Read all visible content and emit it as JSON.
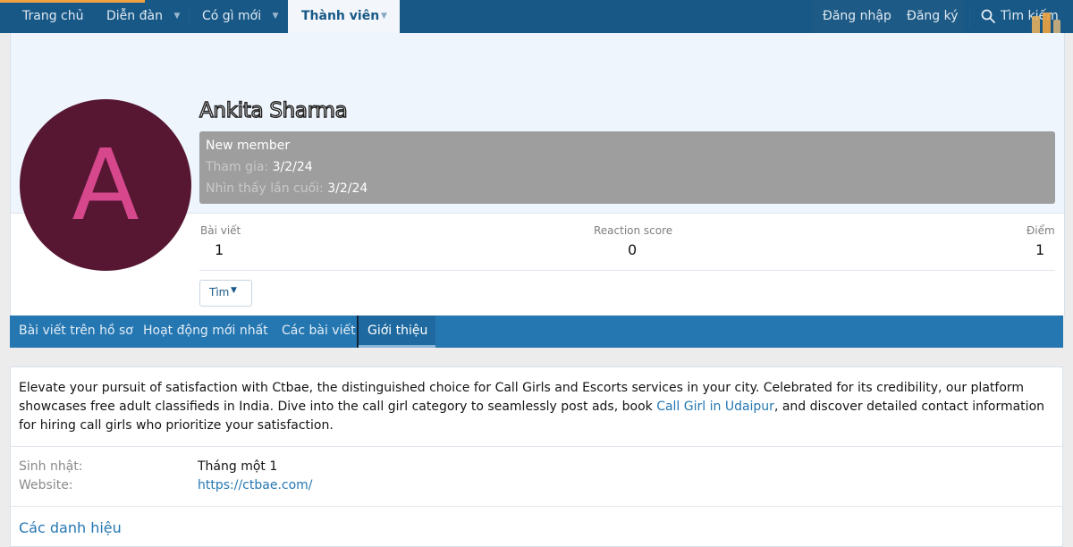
{
  "nav": {
    "home": "Trang chủ",
    "forums": "Diễn đàn",
    "whats_new": "Có gì mới",
    "members": "Thành viên",
    "login": "Đăng nhập",
    "register": "Đăng ký",
    "search": "Tìm kiếm",
    "accent_color": "#f0a340",
    "bar_color": "#185886"
  },
  "profile": {
    "avatar_letter": "A",
    "avatar_bg": "#571733",
    "avatar_fg": "#d6478c",
    "username": "Ankita Sharma",
    "member_title": "New member",
    "joined_label": "Tham gia:",
    "joined_value": "3/2/24",
    "last_seen_label": "Nhìn thấy lần cuối:",
    "last_seen_value": "3/2/24",
    "stats": {
      "posts_label": "Bài viết",
      "posts_value": "1",
      "reaction_label": "Reaction score",
      "reaction_value": "0",
      "points_label": "Điểm",
      "points_value": "1"
    },
    "find_label": "Tìm"
  },
  "tabs": {
    "profile_posts": "Bài viết trên hồ sơ",
    "latest_activity": "Hoạt động mới nhất",
    "postings": "Các bài viết",
    "about": "Giới thiệu"
  },
  "about": {
    "bio_part1": "Elevate your pursuit of satisfaction with Ctbae, the distinguished choice for Call Girls and Escorts services in your city. Celebrated for its credibility, our platform showcases free adult classifieds in India. Dive into the call girl category to seamlessly post ads, book ",
    "bio_link": "Call Girl in Udaipur",
    "bio_part2": ", and discover detailed contact information for hiring call girls who prioritize your satisfaction.",
    "birthday_label": "Sinh nhật:",
    "birthday_value": "Tháng một 1",
    "website_label": "Website:",
    "website_value": "https://ctbae.com/",
    "trophies": "Các danh hiệu"
  }
}
